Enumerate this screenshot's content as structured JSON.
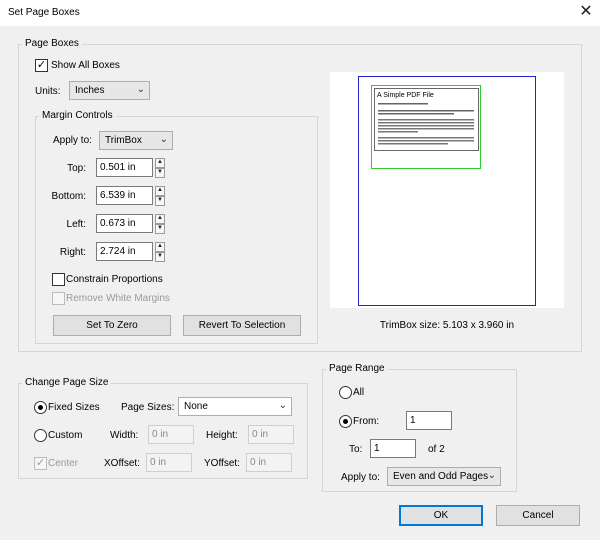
{
  "window": {
    "title": "Set Page Boxes",
    "close_glyph": "✕"
  },
  "page_boxes": {
    "label": "Page Boxes",
    "show_all_boxes": {
      "label": "Show All Boxes",
      "checked": true
    },
    "units": {
      "label": "Units:",
      "value": "Inches"
    },
    "margin_controls": {
      "label": "Margin Controls",
      "apply_to": {
        "label": "Apply to:",
        "value": "TrimBox"
      },
      "top": {
        "label": "Top:",
        "value": "0.501 in"
      },
      "bottom": {
        "label": "Bottom:",
        "value": "6.539 in"
      },
      "left": {
        "label": "Left:",
        "value": "0.673 in"
      },
      "right": {
        "label": "Right:",
        "value": "2.724 in"
      },
      "constrain": {
        "label": "Constrain Proportions",
        "checked": false
      },
      "remove_white": {
        "label": "Remove White Margins",
        "checked": false
      },
      "set_to_zero": "Set To Zero",
      "revert": "Revert To Selection"
    },
    "preview": {
      "heading": "A Simple PDF File",
      "size_text": "TrimBox size: 5.103 x 3.960 in",
      "colors": {
        "media_box": "#2222cc",
        "trim_box": "#33cc33"
      }
    }
  },
  "change_page_size": {
    "label": "Change Page Size",
    "fixed_sizes": {
      "label": "Fixed Sizes",
      "selected": true
    },
    "page_sizes": {
      "label": "Page Sizes:",
      "value": "None"
    },
    "custom": {
      "label": "Custom",
      "selected": false
    },
    "width": {
      "label": "Width:",
      "value": "0 in"
    },
    "height": {
      "label": "Height:",
      "value": "0 in"
    },
    "center": {
      "label": "Center",
      "checked": true
    },
    "xoffset": {
      "label": "XOffset:",
      "value": "0 in"
    },
    "yoffset": {
      "label": "YOffset:",
      "value": "0 in"
    }
  },
  "page_range": {
    "label": "Page Range",
    "all": {
      "label": "All",
      "selected": false
    },
    "from": {
      "label": "From:",
      "value": "1",
      "selected": true
    },
    "to": {
      "label": "To:",
      "value": "1",
      "suffix": "of 2"
    },
    "apply_to": {
      "label": "Apply to:",
      "value": "Even and Odd Pages"
    }
  },
  "buttons": {
    "ok": "OK",
    "cancel": "Cancel"
  },
  "icons": {
    "check": "✓",
    "spin_up": "▲",
    "spin_down": "▼",
    "dropdown": "⌄"
  }
}
